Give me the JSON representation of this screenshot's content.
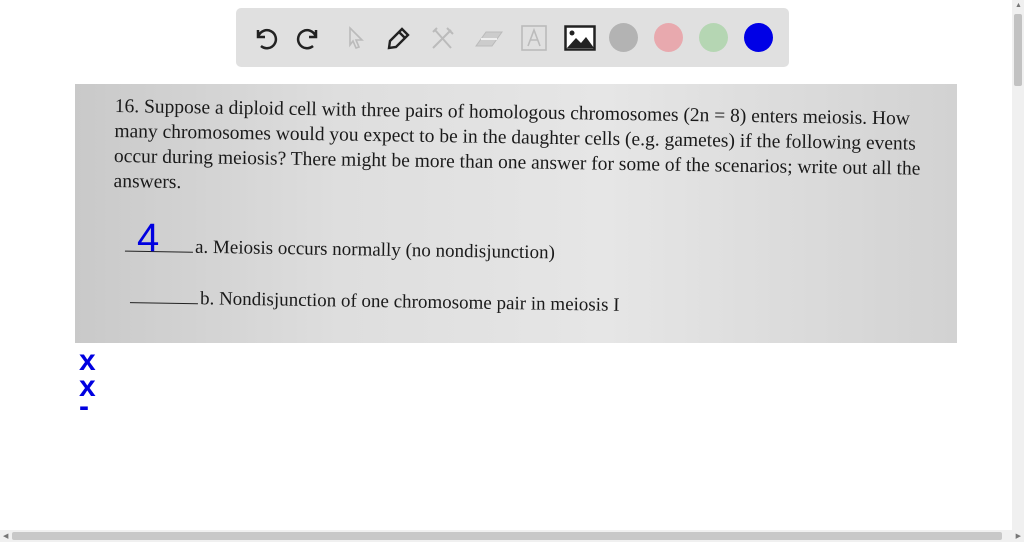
{
  "toolbar": {
    "tools": [
      "undo-icon",
      "redo-icon",
      "select-icon",
      "pen-icon",
      "tools-icon",
      "eraser-icon",
      "text-icon",
      "image-icon"
    ],
    "colors": [
      "#b3b3b3",
      "#e8a9ae",
      "#b5d6b3",
      "#0000e6"
    ]
  },
  "question": {
    "text": "16. Suppose a diploid cell with three pairs of homologous chromosomes (2n = 8) enters meiosis. How many chromosomes would you expect to be in the daughter cells (e.g. gametes) if the following events occur during meiosis? There might be more than one answer for some of the scenarios; write out all the answers.",
    "a": "a. Meiosis occurs normally (no nondisjunction)",
    "b": "b. Nondisjunction of one chromosome pair in meiosis I"
  },
  "handwriting": {
    "answer_a": "4",
    "margin_marks": [
      "x",
      "x",
      "-"
    ]
  }
}
